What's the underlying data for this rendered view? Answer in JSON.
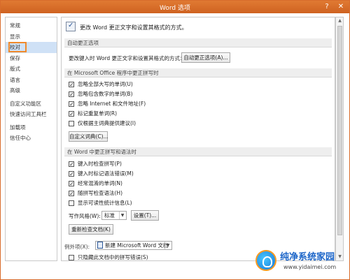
{
  "window": {
    "title": "Word 选项",
    "help": "?",
    "close": "✕"
  },
  "sidebar": {
    "items": [
      {
        "label": "常规"
      },
      {
        "label": "显示"
      },
      {
        "label": "校对"
      },
      {
        "label": "保存"
      },
      {
        "label": "版式"
      },
      {
        "label": "语言"
      },
      {
        "label": "高级"
      },
      {
        "label": "自定义功能区"
      },
      {
        "label": "快速访问工具栏"
      },
      {
        "label": "加载项"
      },
      {
        "label": "信任中心"
      }
    ],
    "selected_index": 2
  },
  "main": {
    "header": "更改 Word 更正文字和设置其格式的方式。",
    "autocorrect": {
      "section": "自动更正选项",
      "text": "更改键入时 Word 更正文字和设置其格式的方式：",
      "button": "自动更正选项(A)..."
    },
    "office": {
      "section": "在 Microsoft Office 程序中更正拼写时",
      "options": [
        {
          "label": "忽略全部大写的单词(U)",
          "checked": true
        },
        {
          "label": "忽略包含数字的单词(B)",
          "checked": true
        },
        {
          "label": "忽略 Internet 和文件地址(F)",
          "checked": true
        },
        {
          "label": "标记重复单词(R)",
          "checked": true
        },
        {
          "label": "仅根据主词典提供建议(I)",
          "checked": false
        }
      ],
      "button": "自定义词典(C)..."
    },
    "word": {
      "section": "在 Word 中更正拼写和语法时",
      "options": [
        {
          "label": "键入时检查拼写(P)",
          "checked": true
        },
        {
          "label": "键入时标记语法错误(M)",
          "checked": true
        },
        {
          "label": "经常混淆的单词(N)",
          "checked": true
        },
        {
          "label": "随拼写检查语法(H)",
          "checked": true
        },
        {
          "label": "显示可读性统计信息(L)",
          "checked": false
        }
      ],
      "style_label": "写作风格(W):",
      "style_value": "标准",
      "settings_button": "设置(T)...",
      "recheck_button": "重新检查文档(K)"
    },
    "exceptions": {
      "label": "例外项(X):",
      "value": "新建 Microsoft Word 文档",
      "option": {
        "label": "只隐藏此文档中的拼写错误(S)",
        "checked": false
      }
    }
  },
  "watermark": {
    "text": "纯净系统家园",
    "url": "www.yidaimei.com"
  }
}
